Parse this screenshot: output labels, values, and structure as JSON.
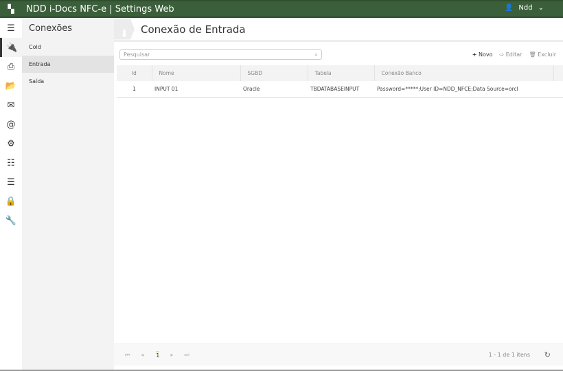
{
  "app": {
    "title": "NDD i-Docs NFC-e | Settings Web",
    "user": "Ndd",
    "brand_color": "#3b5f3a"
  },
  "iconbar": [
    "menu-icon",
    "plug-icon",
    "printer-icon",
    "folder-open-icon",
    "envelope-icon",
    "at-icon",
    "gear-icon",
    "sliders-icon",
    "server-icon",
    "lock-icon",
    "wrench-icon"
  ],
  "submenu": {
    "title": "Conexões",
    "items": [
      {
        "label": "Cold"
      },
      {
        "label": "Entrada"
      },
      {
        "label": "Saída"
      }
    ]
  },
  "page": {
    "title": "Conexão de Entrada"
  },
  "search": {
    "placeholder": "Pesquisar"
  },
  "toolbar": {
    "new": "Novo",
    "edit": "Editar",
    "delete": "Excluir"
  },
  "table": {
    "columns": [
      "Id",
      "Nome",
      "SGBD",
      "Tabela",
      "Conexão Banco"
    ],
    "rows": [
      [
        "1",
        "INPUT 01",
        "Oracle",
        "TBDATABASEINPUT",
        "Password=*****;User ID=NDD_NFCE;Data Source=orcl"
      ]
    ]
  },
  "pager": {
    "page": "1",
    "info": "1 - 1 de 1 itens"
  }
}
